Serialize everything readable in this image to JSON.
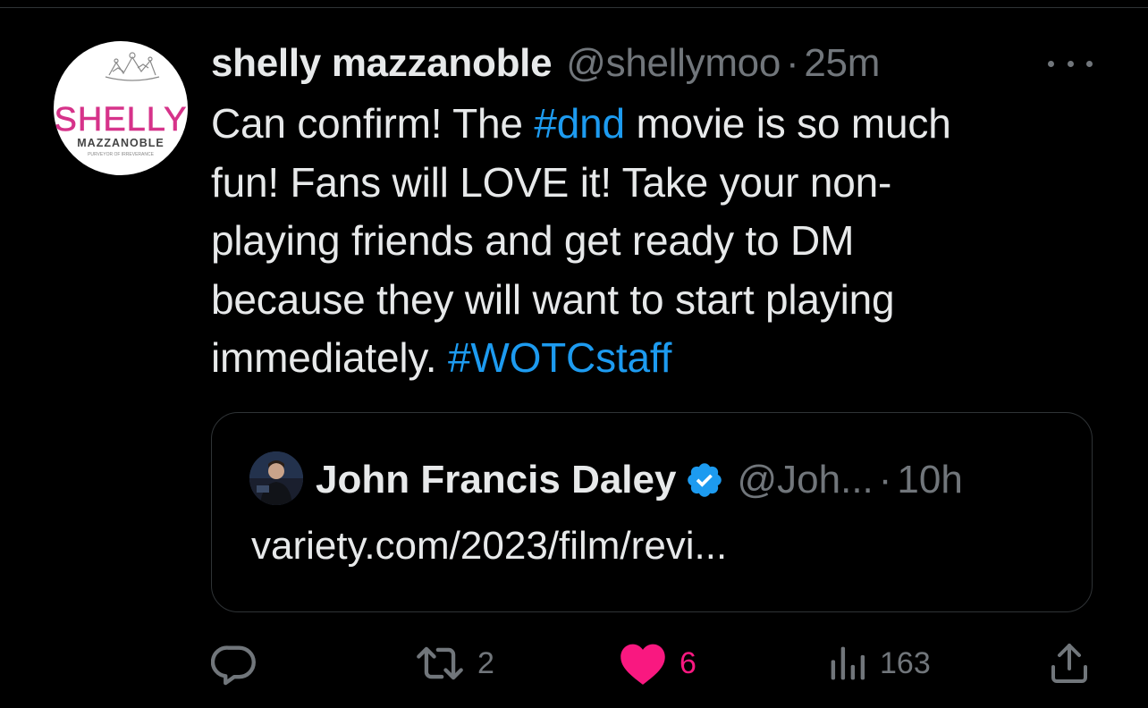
{
  "tweet": {
    "author_name": "shelly mazzanoble",
    "author_handle": "@shellymoo",
    "separator": "·",
    "time": "25m",
    "avatar": {
      "logo_main": "SHELLY",
      "logo_sub": "MAZZANOBLE",
      "logo_tagline": "PURVEYOR OF IRREVERANCE"
    },
    "text_lines": [
      {
        "before": "Can confirm! The ",
        "hashtag": "#dnd",
        "after": " movie is so much"
      },
      {
        "before": "fun!  Fans will LOVE it! Take your non-",
        "hashtag": "",
        "after": ""
      },
      {
        "before": "playing friends and get ready to DM",
        "hashtag": "",
        "after": ""
      },
      {
        "before": "because they will want to start playing",
        "hashtag": "",
        "after": ""
      },
      {
        "before": "immediately. ",
        "hashtag": "#WOTCstaff",
        "after": ""
      }
    ],
    "quote": {
      "name": "John Francis Daley",
      "handle": "@Joh...",
      "separator": "·",
      "time": "10h",
      "text": "variety.com/2023/film/revi..."
    },
    "actions": {
      "reply": {
        "icon": "reply-icon",
        "count": ""
      },
      "retweet": {
        "icon": "retweet-icon",
        "count": "2"
      },
      "like": {
        "icon": "heart-icon",
        "count": "6",
        "liked": true
      },
      "views": {
        "icon": "views-icon",
        "count": "163"
      },
      "share": {
        "icon": "share-icon",
        "count": ""
      }
    }
  },
  "colors": {
    "background": "#000000",
    "text": "#e7e9ea",
    "secondary": "#71767b",
    "hashtag": "#1d9bf0",
    "like": "#f91880",
    "verified": "#1d9bf0",
    "border": "#2f3336",
    "logo_pink": "#d6338a"
  }
}
